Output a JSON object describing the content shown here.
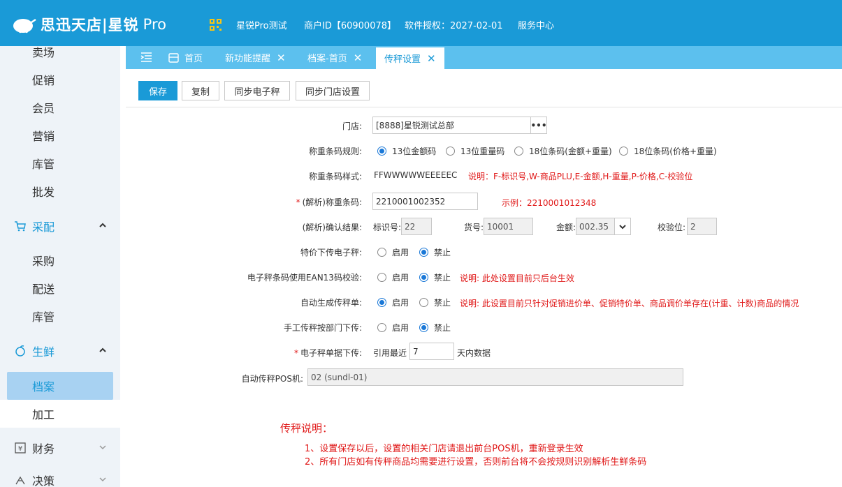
{
  "header": {
    "brand": "思迅天店|星锐",
    "brand_suffix": "Pro",
    "shop_name": "星锐Pro测试",
    "merchant_id": "商户ID【60900078】",
    "license": "软件授权：2027-02-01",
    "service": "服务中心"
  },
  "sidebar": {
    "items": [
      {
        "label": "卖场"
      },
      {
        "label": "促销"
      },
      {
        "label": "会员"
      },
      {
        "label": "营销"
      },
      {
        "label": "库管"
      },
      {
        "label": "批发"
      }
    ],
    "group_purchase": {
      "label": "采配",
      "items": [
        {
          "label": "采购"
        },
        {
          "label": "配送"
        },
        {
          "label": "库管"
        }
      ]
    },
    "group_fresh": {
      "label": "生鲜",
      "items": [
        {
          "label": "档案"
        },
        {
          "label": "加工"
        }
      ]
    },
    "group_finance": {
      "label": "财务"
    },
    "group_decision": {
      "label": "决策"
    }
  },
  "tabs": [
    {
      "label": "首页"
    },
    {
      "label": "新功能提醒"
    },
    {
      "label": "档案-首页"
    },
    {
      "label": "传秤设置"
    }
  ],
  "toolbar": {
    "save": "保存",
    "copy": "复制",
    "sync_scale": "同步电子秤",
    "sync_store": "同步门店设置"
  },
  "form": {
    "store_label": "门店:",
    "store_value": "[8888]星锐测试总部",
    "store_btn": "•••",
    "rule_label": "称重条码规则:",
    "rule_options": [
      "13位金额码",
      "13位重量码",
      "18位条码(金额+重量)",
      "18位条码(价格+重量)"
    ],
    "rule_selected": 0,
    "style_label": "称重条码样式:",
    "style_value": "FFWWWWWEEEEEC",
    "style_note": "说明：F-标识号,W-商品PLU,E-金额,H-重量,P-价格,C-校验位",
    "parse_label": "(解析)称重条码:",
    "parse_value": "2210001002352",
    "parse_example": "示例：2210001012348",
    "confirm_label": "(解析)确认结果:",
    "id_label": "标识号:",
    "id_value": "22",
    "sku_label": "货号:",
    "sku_value": "10001",
    "amount_label": "金额:",
    "amount_value": "002.35",
    "check_label": "校验位:",
    "check_value": "2",
    "special_label": "特价下传电子秤:",
    "ean_label": "电子秤条码使用EAN13码校验:",
    "ean_note": "说明: 此处设置目前只后台生效",
    "auto_label": "自动生成传秤单:",
    "auto_note": "说明: 此设置目前只针对促销进价单、促销特价单、商品调价单存在(计重、计数)商品的情况",
    "manual_label": "手工传秤按部门下传:",
    "enable": "启用",
    "disable": "禁止",
    "special_enabled": false,
    "ean_enabled": false,
    "auto_enabled": true,
    "manual_enabled": false,
    "download_label": "电子秤单据下传:",
    "download_prefix": "引用最近",
    "download_days": "7",
    "download_suffix": "天内数据",
    "pos_label": "自动传秤POS机:",
    "pos_value": "02 (sundl-01)"
  },
  "explain": {
    "title": "传秤说明：",
    "line1": "1、设置保存以后，设置的相关门店请退出前台POS机，重新登录生效",
    "line2": "2、所有门店如有传秤商品均需要进行设置，否则前台将不会按规则识别解析生鲜条码"
  }
}
